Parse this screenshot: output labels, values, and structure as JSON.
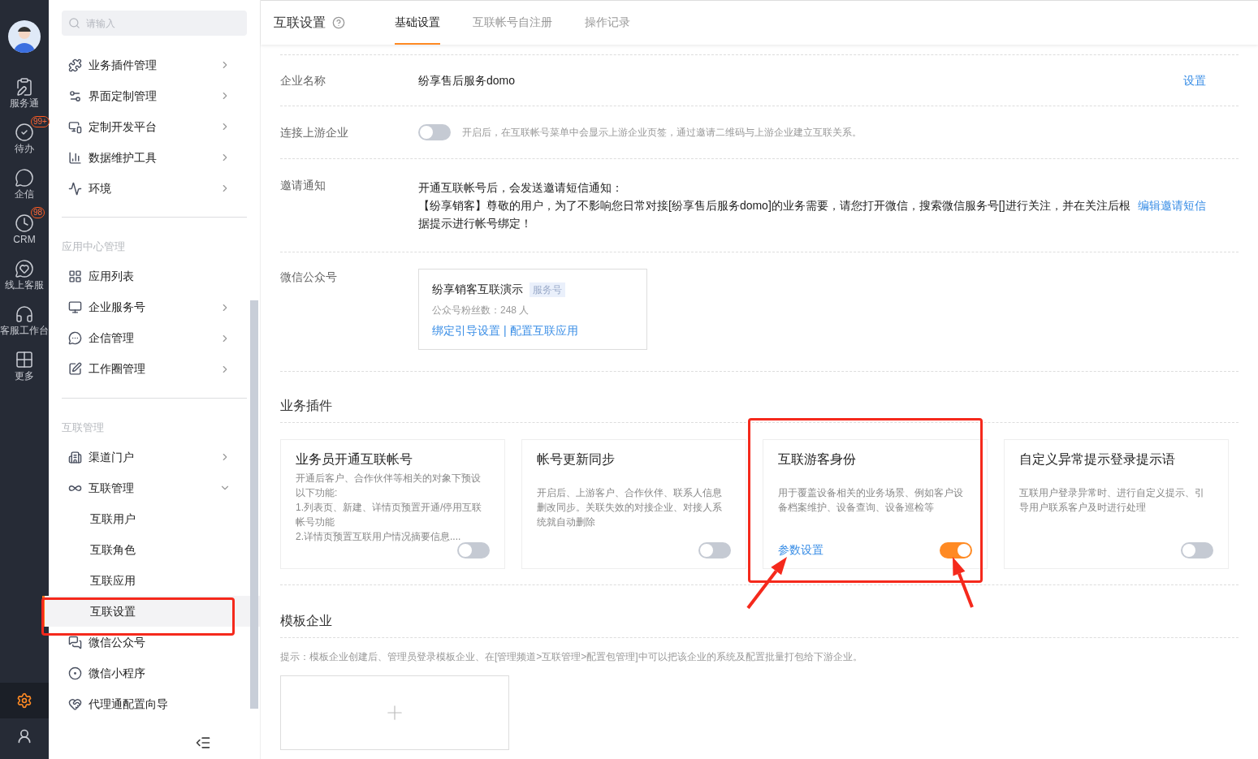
{
  "rail": {
    "items": [
      {
        "label": "服务通"
      },
      {
        "label": "待办",
        "badge": "99+"
      },
      {
        "label": "企信"
      },
      {
        "label": "CRM",
        "badge": "98"
      },
      {
        "label": "线上客服"
      },
      {
        "label": "客服工作台"
      },
      {
        "label": "更多"
      }
    ]
  },
  "sidebar": {
    "search": {
      "placeholder": "请输入"
    },
    "groups": [
      {
        "items": [
          {
            "label": "业务插件管理",
            "expanded": false,
            "selected": false
          },
          {
            "label": "界面定制管理",
            "expanded": false,
            "selected": false
          },
          {
            "label": "定制开发平台",
            "expanded": false,
            "selected": false
          },
          {
            "label": "数据维护工具",
            "expanded": false,
            "selected": false
          },
          {
            "label": "环境",
            "expanded": false,
            "selected": false
          }
        ]
      },
      {
        "title": "应用中心管理",
        "items": [
          {
            "label": "应用列表",
            "selected": false
          },
          {
            "label": "企业服务号",
            "expanded": false,
            "selected": false
          },
          {
            "label": "企信管理",
            "expanded": false,
            "selected": false
          },
          {
            "label": "工作圈管理",
            "expanded": false,
            "selected": false
          }
        ]
      },
      {
        "title": "互联管理",
        "items": [
          {
            "label": "渠道门户",
            "expanded": false,
            "selected": false
          },
          {
            "label": "互联管理",
            "expanded": true,
            "selected": false,
            "children": [
              {
                "label": "互联用户",
                "selected": false
              },
              {
                "label": "互联角色",
                "selected": false
              },
              {
                "label": "互联应用",
                "selected": false
              },
              {
                "label": "互联设置",
                "selected": true
              }
            ]
          },
          {
            "label": "微信公众号",
            "selected": false
          },
          {
            "label": "微信小程序",
            "selected": false
          },
          {
            "label": "代理通配置向导",
            "selected": false
          }
        ]
      }
    ]
  },
  "header": {
    "title": "互联设置",
    "tabs": [
      {
        "label": "基础设置",
        "selected": true
      },
      {
        "label": "互联帐号自注册",
        "selected": false
      },
      {
        "label": "操作记录",
        "selected": false
      }
    ]
  },
  "settings": [
    {
      "kind": "text",
      "label": "企业名称",
      "value": "纷享售后服务domo",
      "action": "设置"
    },
    {
      "kind": "toggle",
      "label": "连接上游企业",
      "on": false,
      "hint": "开启后，在互联帐号菜单中会显示上游企业页签，通过邀请二维码与上游企业建立互联关系。"
    },
    {
      "kind": "invite",
      "label": "邀请通知",
      "intro": "开通互联帐号后，会发送邀请短信通知：",
      "message": "【纷享销客】尊敬的用户，为了不影响您日常对接[纷享售后服务domo]的业务需要，请您打开微信，搜索微信服务号[]进行关注，并在关注后根据提示进行帐号绑定！",
      "action": "编辑邀请短信"
    },
    {
      "kind": "wechat",
      "label": "微信公众号",
      "name": "纷享销客互联演示",
      "tag": "服务号",
      "fans": "公众号粉丝数：248 人",
      "links": [
        "绑定引导设置",
        "配置互联应用"
      ],
      "separator": "|"
    }
  ],
  "plugins": {
    "title": "业务插件",
    "cards": [
      {
        "title": "业务员开通互联帐号",
        "lines": [
          "开通后客户、合作伙伴等相关的对象下预设以下功能:",
          "1.列表页、新建、详情页预置开通/停用互联帐号功能",
          "2.详情页预置互联用户情况摘要信息...."
        ],
        "on": false
      },
      {
        "title": "帐号更新同步",
        "lines": [
          "开启后、上游客户、合作伙伴、联系人信息删改同步。关联失效的对接企业、对接人系统就自动删除"
        ],
        "on": false
      },
      {
        "title": "互联游客身份",
        "lines": [
          "用于覆盖设备相关的业务场景、例如客户设备档案维护、设备查询、设备巡检等"
        ],
        "link": "参数设置",
        "on": true
      },
      {
        "title": "自定义异常提示登录提示语",
        "lines": [
          "互联用户登录异常时、进行自定义提示、引导用户联系客户及时进行处理"
        ],
        "on": false
      }
    ]
  },
  "templates": {
    "title": "模板企业",
    "hint": "提示：模板企业创建后、管理员登录模板企业、在[管理频道>互联管理>配置包管理]中可以把该企业的系统及配置批量打包给下游企业。"
  }
}
